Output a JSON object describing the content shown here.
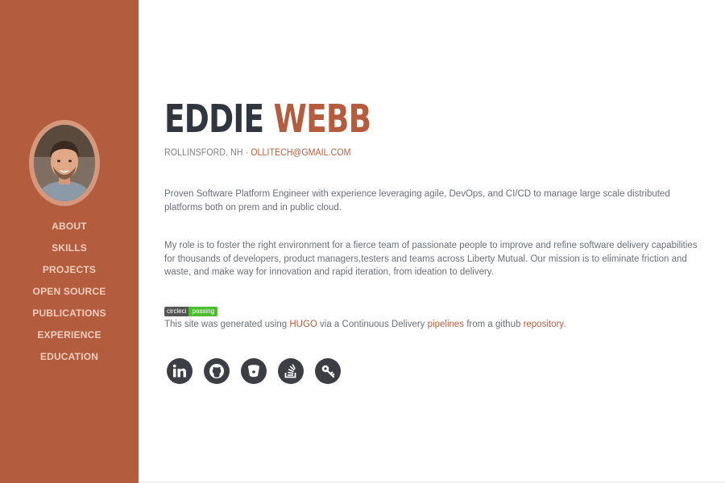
{
  "sidebar": {
    "nav": [
      "ABOUT",
      "SKILLS",
      "PROJECTS",
      "OPEN SOURCE",
      "PUBLICATIONS",
      "EXPERIENCE",
      "EDUCATION"
    ]
  },
  "header": {
    "first_name": "EDDIE",
    "last_name": "WEBB",
    "location": "ROLLINSFORD, NH · ",
    "email": "OLLITECH@GMAIL.COM"
  },
  "about": {
    "paragraph1": "Proven Software Platform Engineer with experience leveraging agile, DevOps, and CI/CD to manage large scale distributed platforms both on prem and in public cloud.",
    "paragraph2": "My role is to foster the right environment for a fierce team of passionate people to improve and refine software delivery capabilities for thousands of developers, product managers,testers and teams across Liberty Mutual. Our mission is to eliminate friction and waste, and make way for innovation and rapid iteration, from ideation to delivery."
  },
  "badge": {
    "left": "circleci",
    "right": "passing"
  },
  "generated": {
    "t1": "This site was generated using ",
    "link1": "HUGO",
    "t2": " via a Continuous Delivery ",
    "link2": "pipelines",
    "t3": " from a github ",
    "link3": "repository",
    "t4": "."
  },
  "social_icons": [
    "linkedin-icon",
    "github-icon",
    "bitbucket-icon",
    "stackoverflow-icon",
    "keybase-icon"
  ],
  "colors": {
    "sidebar_bg": "#b35c3e",
    "accent": "#b35c3e",
    "nav_text": "#f1cdbd",
    "name_dark": "#2f3640",
    "icon_bg": "#3b3f45"
  }
}
